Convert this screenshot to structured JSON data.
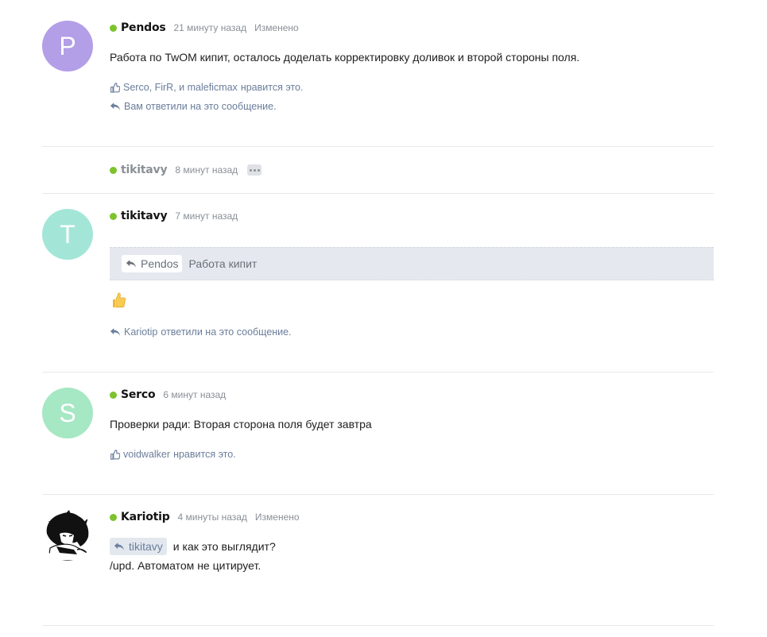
{
  "posts": [
    {
      "avatar_letter": "P",
      "avatar_color": "#b39ee8",
      "author": "Pendos",
      "time": "21 минуту назад",
      "edited": "Изменено",
      "text": "Работа по TwOM кипит, осталось доделать корректировку доливок и второй стороны поля.",
      "likes_users": "Serco, FirR, и maleficmax",
      "likes_suffix": "нравится это.",
      "reply_note": "Вам ответили на это сообщение."
    },
    {
      "author": "tikitavy",
      "time": "8 минут назад",
      "collapsed": true
    },
    {
      "avatar_letter": "T",
      "avatar_color": "#a3e6d8",
      "author": "tikitavy",
      "time": "7 минут назад",
      "quote_author": "Pendos",
      "quote_text": "Работа кипит",
      "emoji": "thumbs-up",
      "reply_user": "Kariotip",
      "reply_suffix": "ответили на это сообщение."
    },
    {
      "avatar_letter": "S",
      "avatar_color": "#a6e7c4",
      "author": "Serco",
      "time": "6 минут назад",
      "text": "Проверки ради: Вторая сторона поля будет завтра",
      "likes_users": "voidwalker",
      "likes_suffix": "нравится это."
    },
    {
      "author": "Kariotip",
      "time": "4 минуты назад",
      "edited": "Изменено",
      "mention": "tikitavy",
      "text_line1": "и как это выглядит?",
      "text_line2": "/upd. Автоматом не цитирует."
    }
  ],
  "colors": {
    "online": "#7cc32d",
    "link": "#6a7e9b",
    "quote_bg": "#e5e9ef"
  }
}
